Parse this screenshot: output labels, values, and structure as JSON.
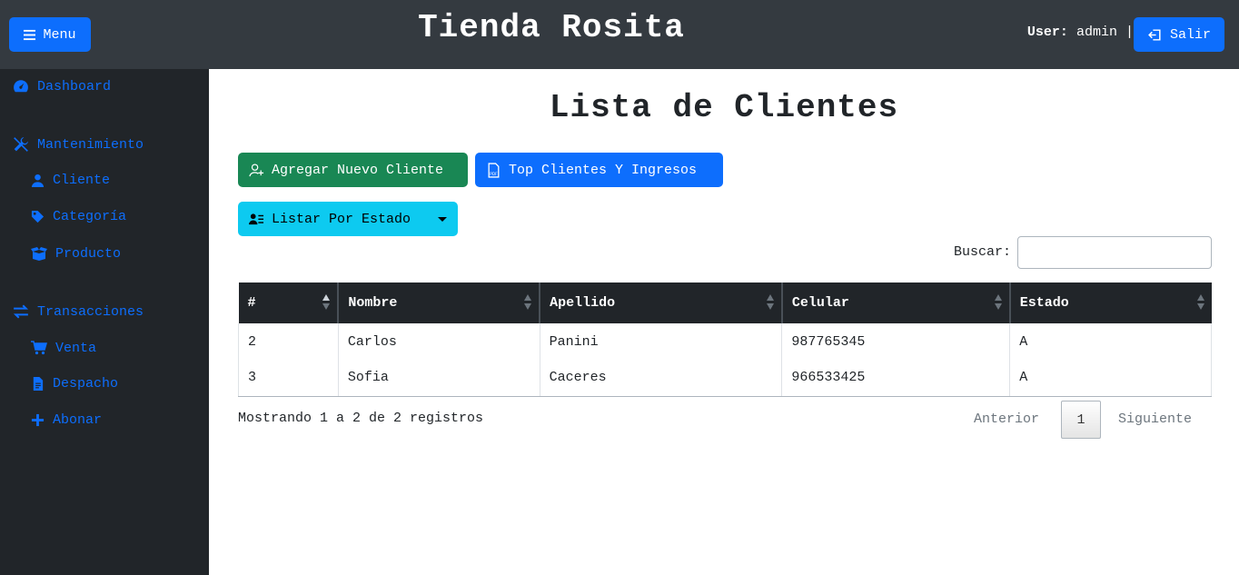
{
  "header": {
    "menu_label": "Menu",
    "brand": "Tienda Rosita",
    "user_label": "User:",
    "user_name": "admin",
    "separator": "|",
    "logout_label": "Salir"
  },
  "sidebar": {
    "dashboard": "Dashboard",
    "mantenimiento": "Mantenimiento",
    "cliente": "Cliente",
    "categoria": "Categoría",
    "producto": "Producto",
    "transacciones": "Transacciones",
    "venta": "Venta",
    "despacho": "Despacho",
    "abonar": "Abonar"
  },
  "main": {
    "title": "Lista de Clientes",
    "add_button": "Agregar Nuevo Cliente",
    "top_button": "Top Clientes Y Ingresos",
    "filter_button": "Listar Por Estado",
    "search_label": "Buscar:",
    "search_value": ""
  },
  "table": {
    "columns": [
      "#",
      "Nombre",
      "Apellido",
      "Celular",
      "Estado"
    ],
    "rows": [
      [
        "2",
        "Carlos",
        "Panini",
        "987765345",
        "A"
      ],
      [
        "3",
        "Sofia",
        "Caceres",
        "966533425",
        "A"
      ]
    ]
  },
  "footer": {
    "info": "Mostrando 1 a 2 de 2 registros",
    "prev": "Anterior",
    "page": "1",
    "next": "Siguiente"
  },
  "colors": {
    "topbar": "#343a40",
    "sidebar": "#212529",
    "primary": "#0d6efd",
    "success": "#198754",
    "info": "#0dcaf0"
  }
}
